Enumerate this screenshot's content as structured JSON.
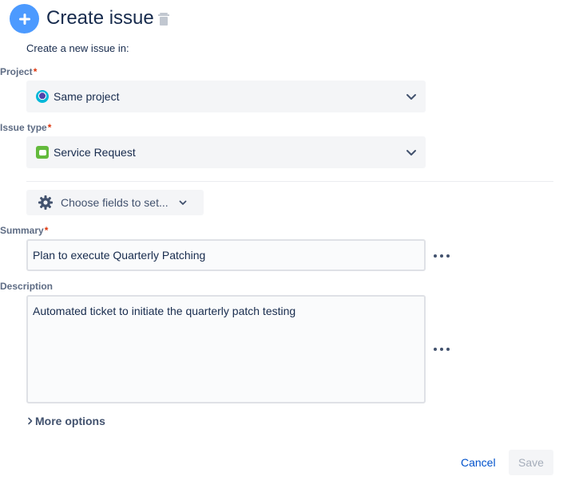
{
  "header": {
    "title": "Create issue",
    "icon": "plus-circle-icon",
    "delete_icon": "trash-icon",
    "accent": "#4c9aff"
  },
  "intro": "Create a new issue in:",
  "project": {
    "label": "Project",
    "required": "*",
    "value": "Same project",
    "icon": "project-avatar-icon"
  },
  "issue_type": {
    "label": "Issue type",
    "required": "*",
    "value": "Service Request",
    "icon": "service-request-icon"
  },
  "choose_fields": {
    "label": "Choose fields to set...",
    "icon": "gear-icon"
  },
  "summary": {
    "label": "Summary",
    "required": "*",
    "value": "Plan to execute Quarterly Patching"
  },
  "description": {
    "label": "Description",
    "value": "Automated ticket to initiate the quarterly patch testing"
  },
  "more_options": "More options",
  "footer": {
    "cancel": "Cancel",
    "save": "Save"
  },
  "colors": {
    "required": "#de350b",
    "link": "#0052cc",
    "field_bg": "#f4f5f7",
    "field_border": "#dfe1e6"
  }
}
